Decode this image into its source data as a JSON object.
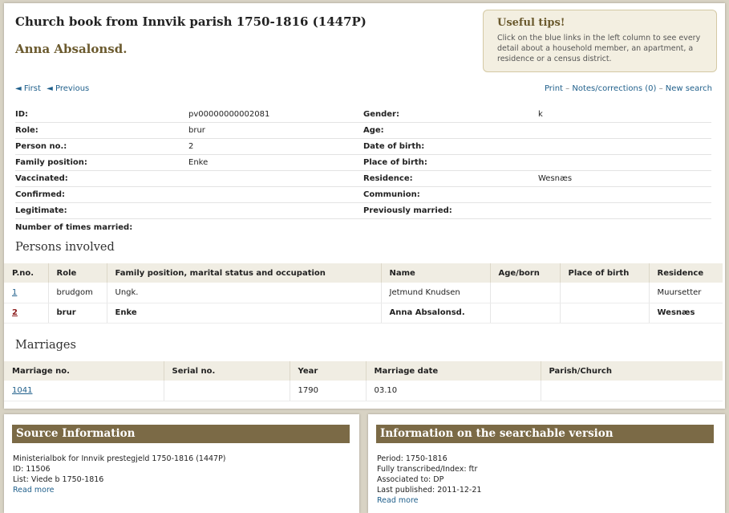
{
  "header": {
    "title": "Church book from Innvik parish 1750-1816 (1447P)",
    "person_name": "Anna Absalonsd."
  },
  "tips": {
    "title": "Useful tips!",
    "text": "Click on the blue links in the left column to see every detail about a household member, an apartment, a residence or a census district."
  },
  "nav": {
    "first": "◄ First",
    "previous": "◄ Previous",
    "print": "Print",
    "sep1": "–",
    "notes": "Notes/corrections (0)",
    "sep2": "–",
    "new_search": "New search"
  },
  "details": [
    {
      "l1": "ID:",
      "v1": "pv00000000002081",
      "l2": "Gender:",
      "v2": "k"
    },
    {
      "l1": "Role:",
      "v1": "brur",
      "l2": "Age:",
      "v2": ""
    },
    {
      "l1": "Person no.:",
      "v1": "2",
      "l2": "Date of birth:",
      "v2": ""
    },
    {
      "l1": "Family position:",
      "v1": "Enke",
      "l2": "Place of birth:",
      "v2": ""
    },
    {
      "l1": "Vaccinated:",
      "v1": "",
      "l2": "Residence:",
      "v2": "Wesnæs"
    },
    {
      "l1": "Confirmed:",
      "v1": "",
      "l2": "Communion:",
      "v2": ""
    },
    {
      "l1": "Legitimate:",
      "v1": "",
      "l2": "Previously married:",
      "v2": ""
    },
    {
      "l1": "Number of times married:",
      "v1": "",
      "l2": "",
      "v2": ""
    }
  ],
  "persons": {
    "title": "Persons involved",
    "columns": [
      "P.no.",
      "Role",
      "Family position, marital status and occupation",
      "Name",
      "Age/born",
      "Place of birth",
      "Residence"
    ],
    "rows": [
      {
        "pno": "1",
        "role": "brudgom",
        "position": "Ungk.",
        "name": "Jetmund Knudsen",
        "age": "",
        "birthplace": "",
        "residence": "Muursetter"
      },
      {
        "pno": "2",
        "role": "brur",
        "position": "Enke",
        "name": "Anna Absalonsd.",
        "age": "",
        "birthplace": "",
        "residence": "Wesnæs"
      }
    ]
  },
  "marriages": {
    "title": "Marriages",
    "columns": [
      "Marriage no.",
      "Serial no.",
      "Year",
      "Marriage date",
      "Parish/Church"
    ],
    "rows": [
      {
        "no": "1041",
        "serial": "",
        "year": "1790",
        "date": "03.10",
        "parish": ""
      }
    ]
  },
  "source": {
    "title": "Source Information",
    "line1": "Ministerialbok for Innvik prestegjeld 1750-1816 (1447P)",
    "line2": "ID: 11506",
    "line3": "List: Viede b 1750-1816",
    "read_more": "Read more"
  },
  "version": {
    "title": "Information on the searchable version",
    "line1": "Period: 1750-1816",
    "line2": "Fully transcribed/Index: ftr",
    "line3": "Associated to: DP",
    "line4": "Last published: 2011-12-21",
    "read_more": "Read more"
  }
}
